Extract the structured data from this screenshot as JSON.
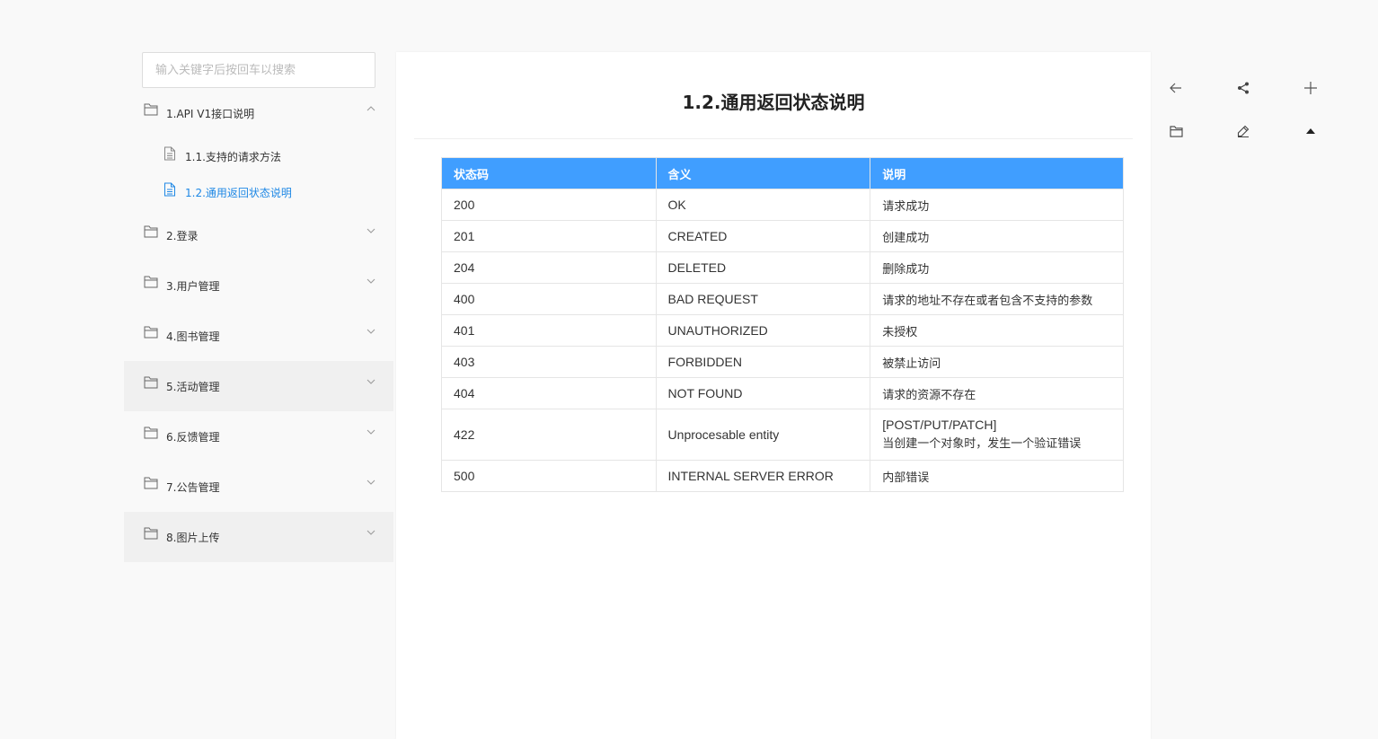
{
  "sidebar": {
    "search_placeholder": "输入关键字后按回车以搜索",
    "items": [
      {
        "label": "1.API V1接口说明",
        "expanded": true,
        "children": [
          {
            "label": "1.1.支持的请求方法",
            "active": false
          },
          {
            "label": "1.2.通用返回状态说明",
            "active": true
          }
        ]
      },
      {
        "label": "2.登录"
      },
      {
        "label": "3.用户管理"
      },
      {
        "label": "4.图书管理"
      },
      {
        "label": "5.活动管理"
      },
      {
        "label": "6.反馈管理"
      },
      {
        "label": "7.公告管理"
      },
      {
        "label": "8.图片上传"
      }
    ]
  },
  "doc": {
    "title": "1.2.通用返回状态说明",
    "table": {
      "headers": [
        "状态码",
        "含义",
        "说明"
      ],
      "rows": [
        [
          "200",
          "OK",
          "请求成功"
        ],
        [
          "201",
          "CREATED",
          "创建成功"
        ],
        [
          "204",
          "DELETED",
          "删除成功"
        ],
        [
          "400",
          "BAD REQUEST",
          "请求的地址不存在或者包含不支持的参数"
        ],
        [
          "401",
          "UNAUTHORIZED",
          "未授权"
        ],
        [
          "403",
          "FORBIDDEN",
          "被禁止访问"
        ],
        [
          "404",
          "NOT FOUND",
          "请求的资源不存在"
        ],
        [
          "422",
          "Unprocesable entity",
          "[POST/PUT/PATCH]",
          "当创建一个对象时，发生一个验证错误"
        ],
        [
          "500",
          "INTERNAL SERVER ERROR",
          "内部错误"
        ]
      ]
    }
  },
  "colors": {
    "accent": "#409eff",
    "active_link": "#1e88e5"
  },
  "toolbar": {
    "icons": [
      "arrow-left-icon",
      "share-icon",
      "plus-icon",
      "folder-icon",
      "edit-icon",
      "caret-up-icon"
    ]
  }
}
